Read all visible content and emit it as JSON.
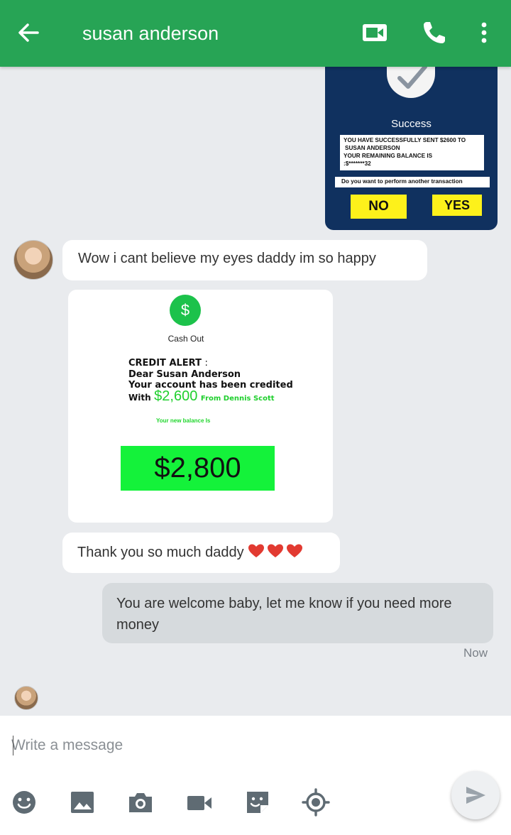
{
  "header": {
    "contact_name": "susan anderson",
    "icons": [
      "back-arrow-icon",
      "video-call-icon",
      "phone-icon",
      "more-vert-icon"
    ]
  },
  "transfer_image": {
    "title": "Success",
    "lines": [
      "YOU HAVE SUCCESSFULLY SENT $2600 TO",
      "SUSAN ANDERSON",
      "YOUR REMAINING BALANCE IS",
      ":$*******32"
    ],
    "prompt": "Do you want to perform another transaction",
    "no_label": "NO",
    "yes_label": "YES"
  },
  "messages": [
    {
      "direction": "in",
      "text": "Wow i cant believe my eyes daddy im so happy"
    },
    {
      "direction": "in",
      "text": "Thank you so much daddy",
      "emoji": "❤️❤️❤️"
    },
    {
      "direction": "out",
      "text": "You are welcome baby, let me know if you need more money",
      "time": "Now"
    }
  ],
  "credit_image": {
    "icon_symbol": "$",
    "header": "Cash Out",
    "alert_title": "CREDIT ALERT",
    "alert_colon": ":",
    "line2": "Dear Susan Anderson",
    "line3": "Your account has been credited",
    "with_label": "With",
    "amount": "$2,600",
    "from": "From Dennis Scott",
    "new_balance_label": "Your new balance Is",
    "balance": "$2,800"
  },
  "compose": {
    "placeholder": "Write a message",
    "tools": [
      "emoji-icon",
      "image-icon",
      "camera-icon",
      "video-icon",
      "sticker-icon",
      "location-icon"
    ]
  },
  "colors": {
    "header_green": "#27a455",
    "chat_background": "#e9ebee",
    "outgoing_bubble": "#d6dadd",
    "transfer_card_navy": "#10315f",
    "balance_green": "#14f23a",
    "button_yellow": "#fdf11b"
  }
}
